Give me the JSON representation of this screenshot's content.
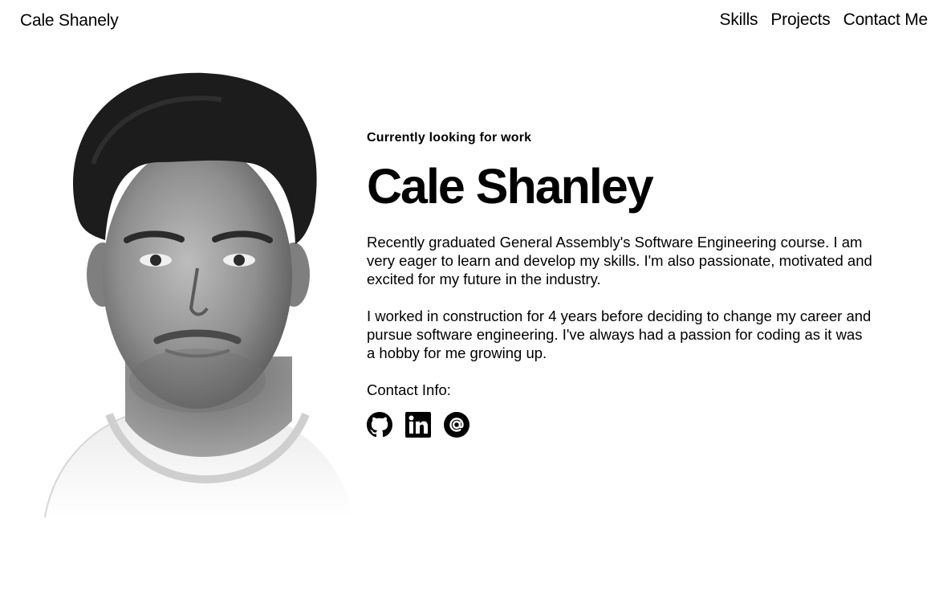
{
  "nav": {
    "brand": "Cale Shanely",
    "links": [
      "Skills",
      "Projects",
      "Contact Me"
    ]
  },
  "hero": {
    "eyebrow": "Currently looking for work",
    "name": "Cale Shanley",
    "paragraphs": [
      "Recently graduated General Assembly's Software Engineering course. I am very eager to learn and develop my skills. I'm also passionate, motivated and excited for my future in the industry.",
      "I worked in construction for 4 years before deciding to change my career and pursue software engineering. I've always had a passion for coding as it was a hobby for me growing up."
    ],
    "contact_label": "Contact Info:",
    "contact_icons": [
      "github-icon",
      "linkedin-icon",
      "email-at-icon"
    ]
  }
}
